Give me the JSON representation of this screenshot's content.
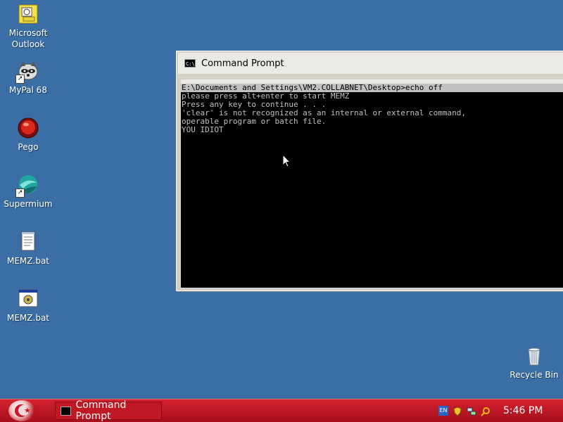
{
  "desktop": {
    "icons": [
      {
        "label": "Microsoft\nOutlook",
        "icon": "outlook-icon"
      },
      {
        "label": "MyPal 68",
        "icon": "mypal-raccoon-icon"
      },
      {
        "label": "Pego",
        "icon": "pego-red-orb-icon"
      },
      {
        "label": "Supermium",
        "icon": "supermium-globe-icon"
      },
      {
        "label": "MEMZ.bat",
        "icon": "notepad-document-icon"
      },
      {
        "label": "MEMZ.bat",
        "icon": "batch-file-gear-icon"
      },
      {
        "label": "Recycle Bin",
        "icon": "recycle-bin-icon"
      }
    ]
  },
  "cmd_window": {
    "title": "Command Prompt",
    "lines": [
      "E:\\Documents and Settings\\VM2.COLLABNET\\Desktop>echo off",
      "please press alt+enter to start MEMZ",
      "Press any key to continue . . .",
      "'clear' is not recognized as an internal or external command,",
      "operable program or batch file.",
      "YOU IDIOT"
    ]
  },
  "taskbar": {
    "task_label": "Command Prompt",
    "language": "EN",
    "clock": "5:46 PM"
  },
  "colors": {
    "desktop_bg": "#3b6ea5",
    "taskbar": "#c01824",
    "console_bg": "#000000",
    "console_text": "#c0c0c0"
  }
}
